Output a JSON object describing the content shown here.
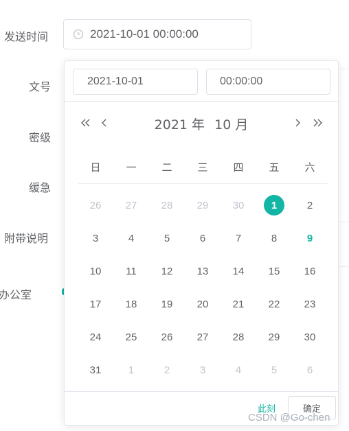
{
  "form": {
    "labels": {
      "send_time": "发送时间",
      "doc_no": "文号",
      "secret_level": "密级",
      "urgency": "缓急",
      "attach_note": "附带说明",
      "office": "办公室"
    },
    "send_time_value": "2021-10-01 00:00:00"
  },
  "picker": {
    "date_input": "2021-10-01",
    "time_input": "00:00:00",
    "year": "2021 年",
    "month": "10 月",
    "weekdays": [
      "日",
      "一",
      "二",
      "三",
      "四",
      "五",
      "六"
    ],
    "weeks": [
      [
        "26",
        "27",
        "28",
        "29",
        "30",
        "1",
        "2"
      ],
      [
        "3",
        "4",
        "5",
        "6",
        "7",
        "8",
        "9"
      ],
      [
        "10",
        "11",
        "12",
        "13",
        "14",
        "15",
        "16"
      ],
      [
        "17",
        "18",
        "19",
        "20",
        "21",
        "22",
        "23"
      ],
      [
        "24",
        "25",
        "26",
        "27",
        "28",
        "29",
        "30"
      ],
      [
        "31",
        "1",
        "2",
        "3",
        "4",
        "5",
        "6"
      ]
    ],
    "selected_day": "1",
    "today_day": "9",
    "now_label": "此刻",
    "confirm_label": "确定"
  },
  "colors": {
    "accent": "#13b5a5",
    "text": "#606266",
    "muted": "#c0c4cc"
  },
  "watermark": "CSDN @Go-chen"
}
